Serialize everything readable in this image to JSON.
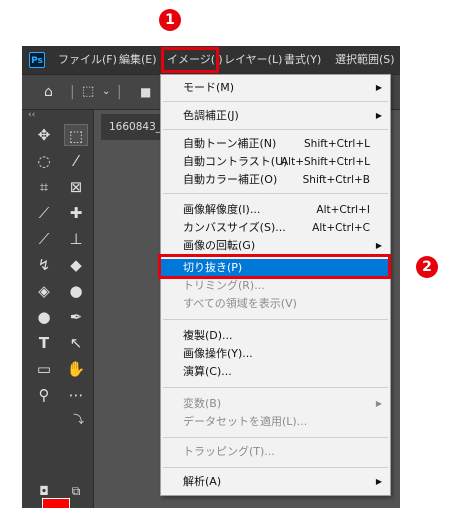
{
  "annotations": {
    "marker1": "1",
    "marker2": "2",
    "highlight_color": "#e8000b"
  },
  "menubar": {
    "logo": "Ps",
    "items": [
      "ファイル(F)",
      "編集(E)",
      "イメージ(I)",
      "レイヤー(L)",
      "書式(Y)",
      "選択範囲(S)"
    ]
  },
  "toolbar": {
    "icons": [
      "home-icon",
      "marquee-icon",
      "chevron-down-icon",
      "square-icon"
    ]
  },
  "tab": {
    "title": "1660843_"
  },
  "tools_panel": {
    "collapse": "‹‹",
    "tools": [
      "move-tool",
      "rect-marquee-tool",
      "lasso-tool",
      "magic-wand-tool",
      "crop-tool",
      "frame-tool",
      "eyedropper-tool",
      "spot-healing-tool",
      "brush-tool",
      "stamp-tool",
      "history-brush-tool",
      "eraser-tool",
      "paint-bucket-tool",
      "blur-tool",
      "dodge-tool",
      "pen-tool",
      "type-tool",
      "path-select-tool",
      "rectangle-tool",
      "hand-tool",
      "zoom-tool",
      "more-tool"
    ],
    "foreground_color": "#ff0000",
    "background_color": "#ffffff"
  },
  "dropdown": {
    "items": [
      {
        "label": "モード(M)",
        "submenu": true
      },
      {
        "label": "色調補正(J)",
        "submenu": true
      },
      {
        "label": "自動トーン補正(N)",
        "shortcut": "Shift+Ctrl+L"
      },
      {
        "label": "自動コントラスト(U)",
        "shortcut": "Alt+Shift+Ctrl+L"
      },
      {
        "label": "自動カラー補正(O)",
        "shortcut": "Shift+Ctrl+B"
      },
      {
        "label": "画像解像度(I)...",
        "shortcut": "Alt+Ctrl+I"
      },
      {
        "label": "カンバスサイズ(S)...",
        "shortcut": "Alt+Ctrl+C"
      },
      {
        "label": "画像の回転(G)",
        "submenu": true
      },
      {
        "label": "切り抜き(P)",
        "highlighted": true
      },
      {
        "label": "トリミング(R)...",
        "disabled": true
      },
      {
        "label": "すべての領域を表示(V)",
        "disabled": true
      },
      {
        "label": "複製(D)..."
      },
      {
        "label": "画像操作(Y)..."
      },
      {
        "label": "演算(C)..."
      },
      {
        "label": "変数(B)",
        "submenu": true,
        "disabled": true
      },
      {
        "label": "データセットを適用(L)...",
        "disabled": true
      },
      {
        "label": "トラッピング(T)...",
        "disabled": true
      },
      {
        "label": "解析(A)",
        "submenu": true
      }
    ]
  }
}
